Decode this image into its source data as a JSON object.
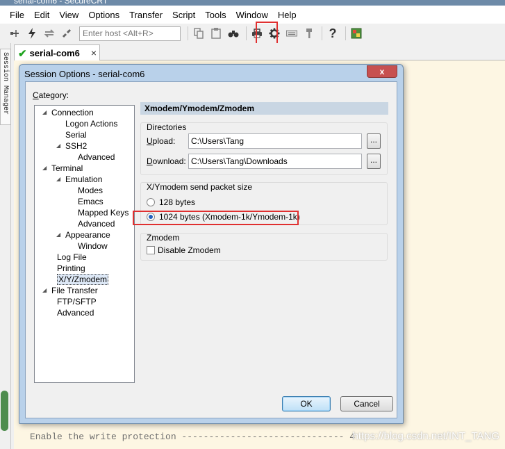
{
  "window": {
    "title": "serial-com6 - SecureCRT"
  },
  "menu": [
    "File",
    "Edit",
    "View",
    "Options",
    "Transfer",
    "Script",
    "Tools",
    "Window",
    "Help"
  ],
  "toolbar": {
    "host_placeholder": "Enter host <Alt+R>",
    "icons_left": [
      "connect-in-tab-icon",
      "lightning-icon",
      "reconnect-icon",
      "disconnect-icon"
    ],
    "icons_right": [
      "copy-icon",
      "paste-icon",
      "find-icon",
      "print-icon",
      "session-options-icon",
      "keymap-icon",
      "key-icon",
      "help-icon",
      "sftp-icon"
    ]
  },
  "tab": {
    "label": "serial-com6",
    "close": "×"
  },
  "sidebar": {
    "session_manager_label": "Session Manager"
  },
  "terminal": {
    "line": "Enable the write protection ------------------------------ 4",
    "watermark": "https://blog.csdn.net/INT_TANG"
  },
  "dialog": {
    "title": "Session Options - serial-com6",
    "close_label": "x",
    "category_label": "Category:",
    "tree": [
      {
        "label": "Connection",
        "level": 0,
        "expander": true
      },
      {
        "label": "Logon Actions",
        "level": 2,
        "expander": false
      },
      {
        "label": "Serial",
        "level": 2,
        "expander": false
      },
      {
        "label": "SSH2",
        "level": 2,
        "expander": true
      },
      {
        "label": "Advanced",
        "level": 3,
        "expander": false
      },
      {
        "label": "Terminal",
        "level": 0,
        "expander": true
      },
      {
        "label": "Emulation",
        "level": 2,
        "expander": true
      },
      {
        "label": "Modes",
        "level": 3,
        "expander": false
      },
      {
        "label": "Emacs",
        "level": 3,
        "expander": false
      },
      {
        "label": "Mapped Keys",
        "level": 3,
        "expander": false
      },
      {
        "label": "Advanced",
        "level": 3,
        "expander": false
      },
      {
        "label": "Appearance",
        "level": 2,
        "expander": true
      },
      {
        "label": "Window",
        "level": 3,
        "expander": false
      },
      {
        "label": "Log File",
        "level": 1,
        "expander": false
      },
      {
        "label": "Printing",
        "level": 1,
        "expander": false
      },
      {
        "label": "X/Y/Zmodem",
        "level": 1,
        "expander": false,
        "selected": true
      },
      {
        "label": "File Transfer",
        "level": 0,
        "expander": true
      },
      {
        "label": "FTP/SFTP",
        "level": 1,
        "expander": false
      },
      {
        "label": "Advanced",
        "level": 1,
        "expander": false
      }
    ],
    "panel_title": "Xmodem/Ymodem/Zmodem",
    "directories": {
      "title": "Directories",
      "upload_label": "Upload:",
      "upload_value": "C:\\Users\\Tang",
      "download_label": "Download:",
      "download_value": "C:\\Users\\Tang\\Downloads",
      "browse_label": "..."
    },
    "packet": {
      "title": "X/Ymodem send packet size",
      "option_128": "128 bytes",
      "option_1024": "1024 bytes  (Xmodem-1k/Ymodem-1k)",
      "selected": "1024"
    },
    "zmodem": {
      "title": "Zmodem",
      "disable_label": "Disable Zmodem",
      "checked": false
    },
    "ok_label": "OK",
    "cancel_label": "Cancel"
  },
  "highlights": {
    "color": "#e03030"
  }
}
